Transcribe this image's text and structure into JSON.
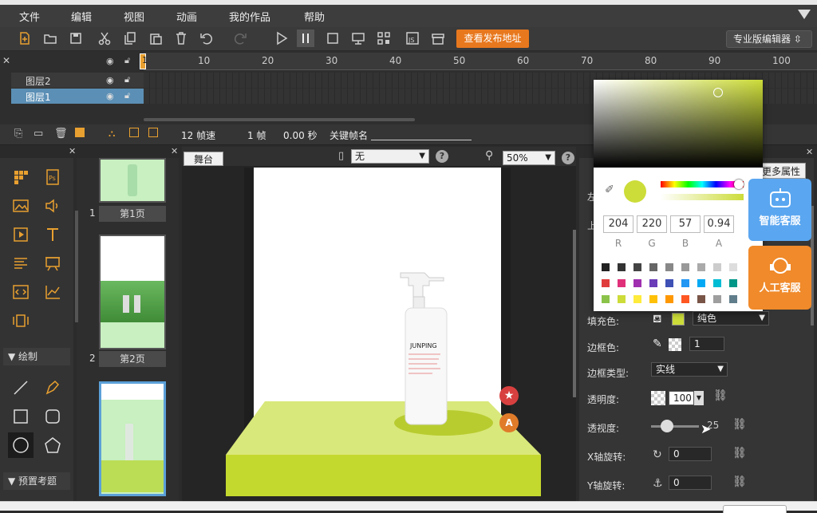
{
  "menu": [
    "文件",
    "编辑",
    "视图",
    "动画",
    "我的作品",
    "帮助"
  ],
  "toolbar": {
    "publish_label": "查看发布地址",
    "editor_mode": "专业版编辑器"
  },
  "timeline": {
    "ruler": [
      "10",
      "20",
      "30",
      "40",
      "50",
      "60",
      "70",
      "80",
      "90",
      "100"
    ],
    "current_frame": "1",
    "layers": [
      {
        "name": "图层2",
        "selected": false
      },
      {
        "name": "图层1",
        "selected": true
      }
    ]
  },
  "timeline_status": {
    "fps": "12 帧速",
    "frame": "1 帧",
    "time": "0.00 秒",
    "keyframe_label": "关键帧名"
  },
  "tools": {
    "draw_section": "绘制",
    "preset_section": "预置考题"
  },
  "pages": [
    {
      "num": "1",
      "label": "第1页"
    },
    {
      "num": "2",
      "label": "第2页"
    },
    {
      "num": "",
      "label": ""
    }
  ],
  "stage": {
    "tab": "舞台",
    "device": "无",
    "zoom": "50%"
  },
  "product": {
    "brand": "JUNPING"
  },
  "props": {
    "more_attrs": "更多属性",
    "left_lab": "左",
    "top_lab": "上",
    "fill_label": "填充色:",
    "fill_type": "纯色",
    "border_color_label": "边框色:",
    "border_width": "1",
    "border_type_label": "边框类型:",
    "border_type": "实线",
    "opacity_label": "透明度:",
    "opacity": "100",
    "perspective_label": "透视度:",
    "perspective": "25",
    "xrot_label": "X轴旋转:",
    "xrot": "0",
    "yrot_label": "Y轴旋转:",
    "yrot": "0"
  },
  "colorpicker": {
    "r": "204",
    "g": "220",
    "b": "57",
    "a": "0.94",
    "labels": [
      "R",
      "G",
      "B",
      "A"
    ],
    "current": "#ccdc39"
  },
  "service": {
    "smart": "智能客服",
    "human": "人工客服"
  }
}
